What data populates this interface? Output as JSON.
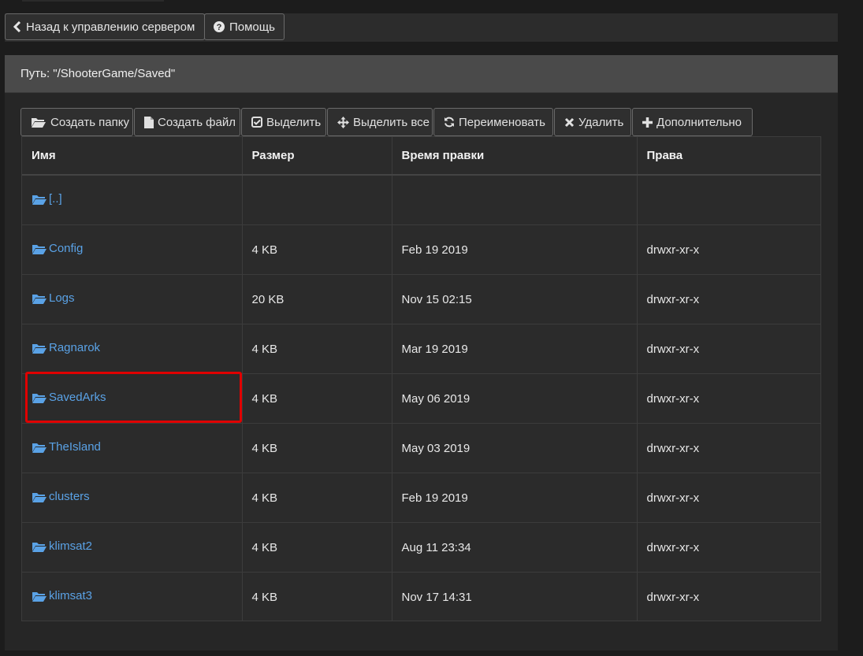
{
  "topbar": {
    "back_label": "Назад к управлению сервером",
    "help_label": "Помощь"
  },
  "panel": {
    "path_label": "Путь: \"/ShooterGame/Saved\""
  },
  "toolbar": [
    {
      "label": "Создать папку",
      "icon": "folder-open-icon"
    },
    {
      "label": "Создать файл",
      "icon": "file-icon"
    },
    {
      "label": "Выделить",
      "icon": "check-square-icon"
    },
    {
      "label": "Выделить все",
      "icon": "move-icon"
    },
    {
      "label": "Переименовать",
      "icon": "refresh-icon"
    },
    {
      "label": "Удалить",
      "icon": "close-icon"
    },
    {
      "label": "Дополнительно",
      "icon": "plus-icon"
    }
  ],
  "table": {
    "headers": [
      "Имя",
      "Размер",
      "Время правки",
      "Права"
    ],
    "rows": [
      {
        "name": "[..]",
        "size": "",
        "modified": "",
        "perms": ""
      },
      {
        "name": "Config",
        "size": "4 KB",
        "modified": "Feb 19 2019",
        "perms": "drwxr-xr-x"
      },
      {
        "name": "Logs",
        "size": "20 KB",
        "modified": "Nov 15 02:15",
        "perms": "drwxr-xr-x"
      },
      {
        "name": "Ragnarok",
        "size": "4 KB",
        "modified": "Mar 19 2019",
        "perms": "drwxr-xr-x"
      },
      {
        "name": "SavedArks",
        "size": "4 KB",
        "modified": "May 06 2019",
        "perms": "drwxr-xr-x"
      },
      {
        "name": "TheIsland",
        "size": "4 KB",
        "modified": "May 03 2019",
        "perms": "drwxr-xr-x"
      },
      {
        "name": "clusters",
        "size": "4 KB",
        "modified": "Feb 19 2019",
        "perms": "drwxr-xr-x"
      },
      {
        "name": "klimsat2",
        "size": "4 KB",
        "modified": "Aug 11 23:34",
        "perms": "drwxr-xr-x"
      },
      {
        "name": "klimsat3",
        "size": "4 KB",
        "modified": "Nov 17 14:31",
        "perms": "drwxr-xr-x"
      }
    ]
  },
  "colors": {
    "link": "#5aa2e6",
    "highlight": "#e00000"
  }
}
